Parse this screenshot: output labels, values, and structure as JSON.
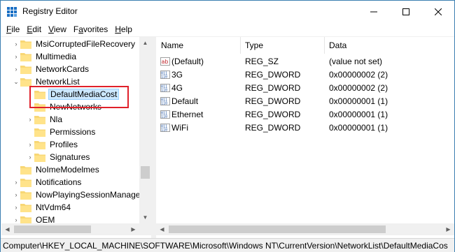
{
  "window": {
    "title": "Registry Editor",
    "accent": "#3c7fb1"
  },
  "titlebar": {
    "icons": [
      "registry-editor-icon",
      "minimize-icon",
      "maximize-icon",
      "close-icon"
    ]
  },
  "menu": [
    {
      "label_prefix": "",
      "underline": "F",
      "label_suffix": "ile"
    },
    {
      "label_prefix": "",
      "underline": "E",
      "label_suffix": "dit"
    },
    {
      "label_prefix": "",
      "underline": "V",
      "label_suffix": "iew"
    },
    {
      "label_prefix": "F",
      "underline": "a",
      "label_suffix": "vorites"
    },
    {
      "label_prefix": "",
      "underline": "H",
      "label_suffix": "elp"
    }
  ],
  "tree": {
    "items": [
      {
        "label": "MsiCorruptedFileRecovery",
        "expander": "›"
      },
      {
        "label": "Multimedia",
        "expander": "›"
      },
      {
        "label": "NetworkCards",
        "expander": "›"
      },
      {
        "label": "NetworkList",
        "expander": "⌄"
      },
      {
        "label": "DefaultMediaCost",
        "expander": ""
      },
      {
        "label": "NewNetworks",
        "expander": ""
      },
      {
        "label": "Nla",
        "expander": "›"
      },
      {
        "label": "Permissions",
        "expander": ""
      },
      {
        "label": "Profiles",
        "expander": "›"
      },
      {
        "label": "Signatures",
        "expander": "›"
      },
      {
        "label": "NoImeModelmes",
        "expander": ""
      },
      {
        "label": "Notifications",
        "expander": "›"
      },
      {
        "label": "NowPlayingSessionManager",
        "expander": "›"
      },
      {
        "label": "NtVdm64",
        "expander": "›"
      },
      {
        "label": "OEM",
        "expander": "›"
      }
    ],
    "selected": "DefaultMediaCost",
    "highlight_color": "#e0202a",
    "selection_color": "#cce8ff"
  },
  "list": {
    "columns": {
      "name": "Name",
      "type": "Type",
      "data": "Data"
    },
    "rows": [
      {
        "name": "(Default)",
        "type": "REG_SZ",
        "data": "(value not set)",
        "icon": "string-value-icon"
      },
      {
        "name": "3G",
        "type": "REG_DWORD",
        "data": "0x00000002 (2)",
        "icon": "binary-value-icon"
      },
      {
        "name": "4G",
        "type": "REG_DWORD",
        "data": "0x00000002 (2)",
        "icon": "binary-value-icon"
      },
      {
        "name": "Default",
        "type": "REG_DWORD",
        "data": "0x00000001 (1)",
        "icon": "binary-value-icon"
      },
      {
        "name": "Ethernet",
        "type": "REG_DWORD",
        "data": "0x00000001 (1)",
        "icon": "binary-value-icon"
      },
      {
        "name": "WiFi",
        "type": "REG_DWORD",
        "data": "0x00000001 (1)",
        "icon": "binary-value-icon"
      }
    ]
  },
  "statusbar": {
    "path": "Computer\\HKEY_LOCAL_MACHINE\\SOFTWARE\\Microsoft\\Windows NT\\CurrentVersion\\NetworkList\\DefaultMediaCos"
  }
}
